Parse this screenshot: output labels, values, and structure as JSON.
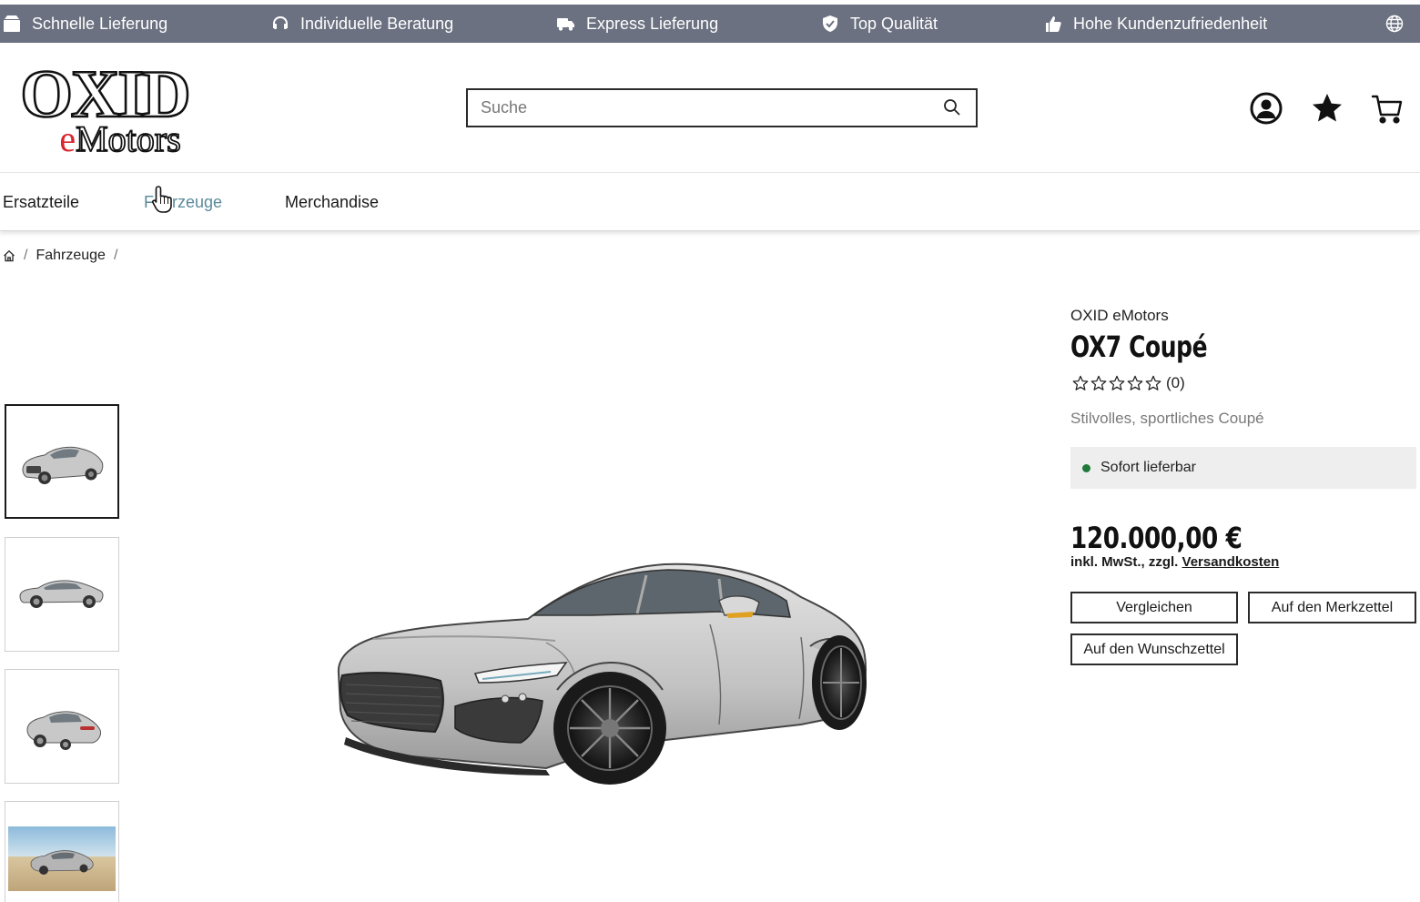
{
  "topbar": {
    "usps": [
      {
        "label": "Schnelle Lieferung",
        "icon": "package-icon"
      },
      {
        "label": "Individuelle Beratung",
        "icon": "headset-icon"
      },
      {
        "label": "Express Lieferung",
        "icon": "truck-icon"
      },
      {
        "label": "Top Qualität",
        "icon": "shield-check-icon"
      },
      {
        "label": "Hohe Kundenzufriedenheit",
        "icon": "thumbs-up-icon"
      }
    ],
    "language_icon": "globe-icon"
  },
  "header": {
    "logo": {
      "line1": "OXID",
      "line2_prefix": "e",
      "line2_rest": "Motors"
    },
    "search": {
      "placeholder": "Suche",
      "value": ""
    },
    "icons": [
      "account-icon",
      "favorites-star-icon",
      "cart-icon"
    ]
  },
  "nav": {
    "items": [
      {
        "label": "Ersatzteile"
      },
      {
        "label": "Fahrzeuge",
        "active": true
      },
      {
        "label": "Merchandise"
      }
    ]
  },
  "breadcrumb": {
    "home_icon": "home-icon",
    "items": [
      "Fahrzeuge"
    ],
    "separator": "/"
  },
  "gallery": {
    "thumbnails": [
      "front-three-quarter",
      "side",
      "rear-three-quarter",
      "desert-scene"
    ],
    "active_index": 0
  },
  "product": {
    "brand": "OXID eMotors",
    "title": "OX7 Coupé",
    "rating": {
      "stars": 0,
      "max": 5,
      "count_text": "(0)"
    },
    "short_description": "Stilvolles, sportliches Coupé",
    "stock_status": "Sofort lieferbar",
    "price": "120.000,00 €",
    "vat_prefix": "inkl. MwSt., zzgl.",
    "shipping_link": "Versandkosten",
    "buttons": {
      "compare": "Vergleichen",
      "notice_list": "Auf den Merkzettel",
      "wish_list": "Auf den Wunschzettel"
    }
  },
  "colors": {
    "topbar_bg": "#6b7180",
    "nav_active": "#5a8a9c",
    "in_stock": "#1f7a3a",
    "logo_accent": "#d9252e"
  }
}
